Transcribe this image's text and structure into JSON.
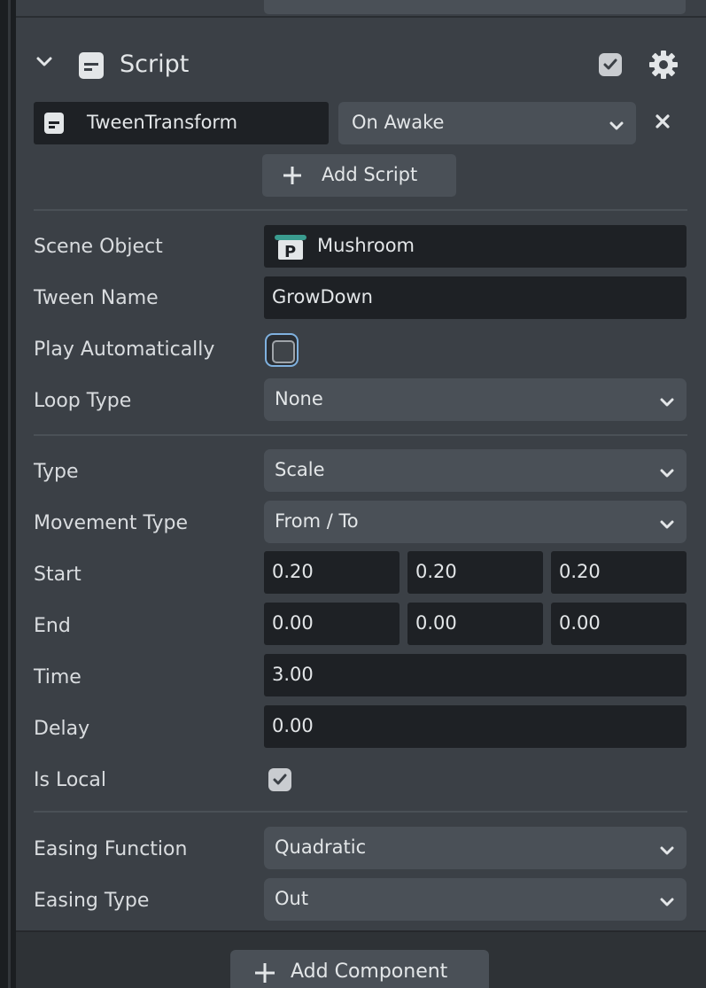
{
  "component": {
    "title": "Script",
    "enabled": true
  },
  "script": {
    "name": "TweenTransform",
    "event": "On Awake",
    "add_script_label": "Add Script"
  },
  "fields": {
    "scene_object": {
      "label": "Scene Object",
      "value": "Mushroom"
    },
    "tween_name": {
      "label": "Tween Name",
      "value": "GrowDown"
    },
    "play_automatically": {
      "label": "Play Automatically",
      "checked": false
    },
    "loop_type": {
      "label": "Loop Type",
      "value": "None"
    },
    "type": {
      "label": "Type",
      "value": "Scale"
    },
    "movement_type": {
      "label": "Movement Type",
      "value": "From / To"
    },
    "start": {
      "label": "Start",
      "x": "0.20",
      "y": "0.20",
      "z": "0.20"
    },
    "end": {
      "label": "End",
      "x": "0.00",
      "y": "0.00",
      "z": "0.00"
    },
    "time": {
      "label": "Time",
      "value": "3.00"
    },
    "delay": {
      "label": "Delay",
      "value": "0.00"
    },
    "is_local": {
      "label": "Is Local",
      "checked": true
    },
    "easing_function": {
      "label": "Easing Function",
      "value": "Quadratic"
    },
    "easing_type": {
      "label": "Easing Type",
      "value": "Out"
    }
  },
  "footer": {
    "add_component_label": "Add Component"
  },
  "colors": {
    "panel": "#3b4046",
    "field_dark": "#1e2125",
    "select_bg": "#4a5057",
    "focus_ring": "#7fb1df",
    "scene_object_icon": "#3a9c8f"
  }
}
